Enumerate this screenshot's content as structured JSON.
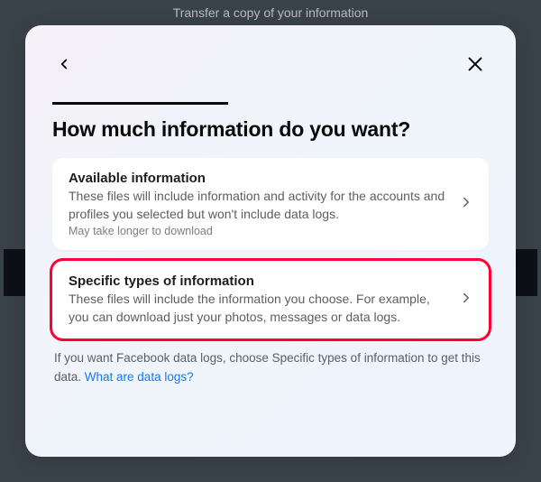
{
  "background": {
    "title": "Transfer a copy of your information"
  },
  "modal": {
    "title": "How much information do you want?",
    "options": [
      {
        "title": "Available information",
        "description": "These files will include information and activity for the accounts and profiles you selected but won't include data logs.",
        "note": "May take longer to download"
      },
      {
        "title": "Specific types of information",
        "description": "These files will include the information you choose. For example, you can download just your photos, messages or data logs."
      }
    ],
    "footer": {
      "text_before": "If you want Facebook data logs, choose Specific types of information to get this data. ",
      "link_text": "What are data logs?"
    }
  }
}
